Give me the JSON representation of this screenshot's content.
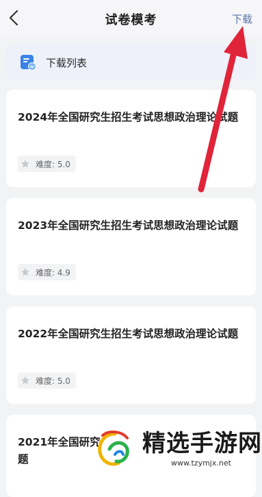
{
  "header": {
    "title": "试卷模考",
    "download_label": "下载"
  },
  "download_list": {
    "label": "下载列表"
  },
  "papers": [
    {
      "title": "2024年全国研究生招生考试思想政治理论试题",
      "rating": "难度: 5.0"
    },
    {
      "title": "2023年全国研究生招生考试思想政治理论试题",
      "rating": "难度: 4.9"
    },
    {
      "title": "2022年全国研究生招生考试思想政治理论试题",
      "rating": "难度: 5.0"
    },
    {
      "title": "2021年全国研究",
      "title_line2": "题"
    }
  ],
  "watermark": {
    "name": "精选手游网",
    "url": "www.tzymjx.net"
  },
  "colors": {
    "accent": "#5a74a8",
    "arrow": "#e0243a",
    "icon": "#3b82e6"
  }
}
